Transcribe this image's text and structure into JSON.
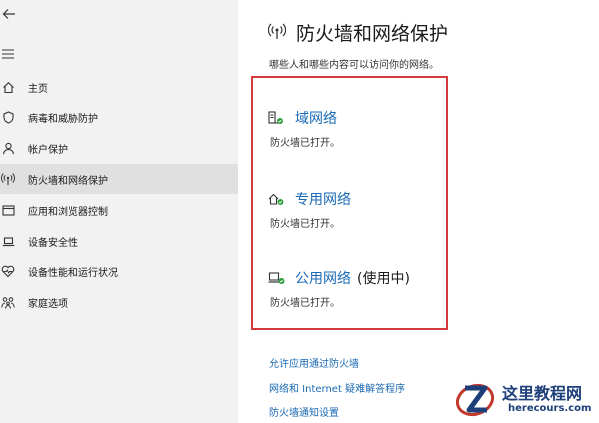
{
  "sidebar": {
    "items": [
      {
        "label": "主页",
        "icon": "home-icon"
      },
      {
        "label": "病毒和威胁防护",
        "icon": "shield-icon"
      },
      {
        "label": "帐户保护",
        "icon": "person-icon"
      },
      {
        "label": "防火墙和网络保护",
        "icon": "wireless-icon",
        "active": true
      },
      {
        "label": "应用和浏览器控制",
        "icon": "app-window-icon"
      },
      {
        "label": "设备安全性",
        "icon": "laptop-icon"
      },
      {
        "label": "设备性能和运行状况",
        "icon": "heart-icon"
      },
      {
        "label": "家庭选项",
        "icon": "family-icon"
      }
    ]
  },
  "main": {
    "title": "防火墙和网络保护",
    "subtitle": "哪些人和哪些内容可以访问你的网络。",
    "networks": [
      {
        "name": "域网络",
        "suffix": "",
        "status": "防火墙已打开。",
        "icon": "domain-network-icon"
      },
      {
        "name": "专用网络",
        "suffix": "",
        "status": "防火墙已打开。",
        "icon": "private-network-icon"
      },
      {
        "name": "公用网络",
        "suffix": "(使用中)",
        "status": "防火墙已打开。",
        "icon": "public-network-icon"
      }
    ],
    "links": [
      "允许应用通过防火墙",
      "网络和 Internet 疑难解答程序",
      "防火墙通知设置"
    ]
  },
  "watermark": {
    "cn": "这里教程网",
    "en": "herecours.com"
  },
  "colors": {
    "accent": "#1b6ab4",
    "highlight_border": "#d33a3a",
    "sidebar_bg": "#f2f2f2",
    "active_item_bg": "#e0e0e0",
    "status_ok": "#2e9d3a"
  }
}
